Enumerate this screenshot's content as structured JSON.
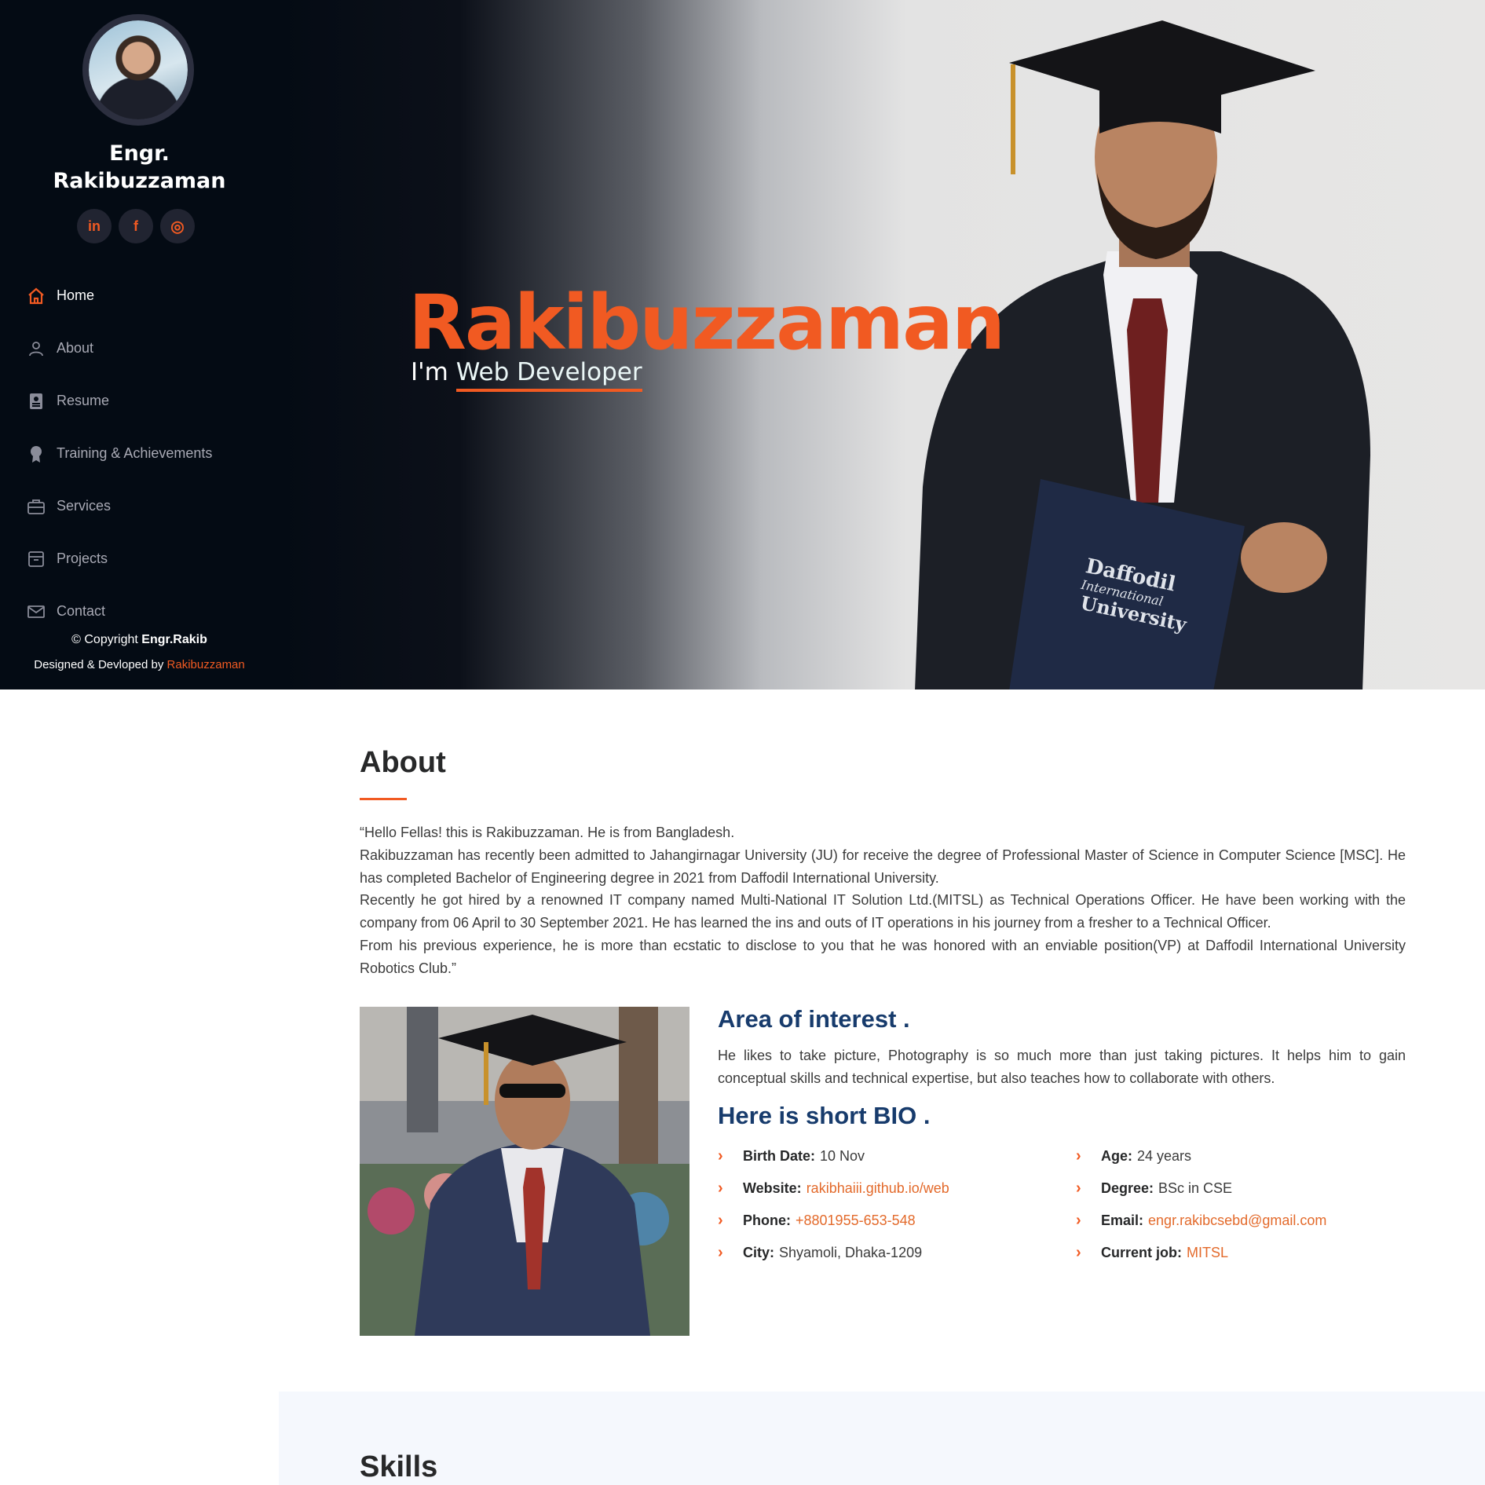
{
  "profile": {
    "name": "Engr. Rakibuzzaman"
  },
  "social": [
    {
      "icon": "linkedin-icon",
      "glyph": "in"
    },
    {
      "icon": "facebook-icon",
      "glyph": "f"
    },
    {
      "icon": "instagram-icon",
      "glyph": "◎"
    }
  ],
  "nav": [
    {
      "label": "Home",
      "icon": "home-icon",
      "active": true
    },
    {
      "label": "About",
      "icon": "person-icon"
    },
    {
      "label": "Resume",
      "icon": "resume-icon"
    },
    {
      "label": "Training & Achievements",
      "icon": "award-icon"
    },
    {
      "label": "Services",
      "icon": "briefcase-icon"
    },
    {
      "label": "Projects",
      "icon": "archive-icon"
    },
    {
      "label": "Contact",
      "icon": "envelope-icon"
    }
  ],
  "footer": {
    "copyright_prefix": "© Copyright ",
    "copyright_name": "Engr.Rakib",
    "designed_prefix": "Designed & Devloped by ",
    "designed_name": "Rakibuzzaman"
  },
  "hero": {
    "title": "Rakibuzzaman",
    "prefix": "I'm ",
    "typed": "Web Developer",
    "book_text_1": "Daffodil",
    "book_text_2": "International",
    "book_text_3": "University"
  },
  "about": {
    "title": "About",
    "paragraphs": [
      "“Hello Fellas! this is Rakibuzzaman. He is from Bangladesh.",
      "Rakibuzzaman has recently been admitted to Jahangirnagar University (JU) for receive the degree of Professional Master of Science in Computer Science [MSC]. He has completed Bachelor of Engineering degree in 2021 from Daffodil International University.",
      "Recently he got hired by a renowned IT company named Multi-National IT Solution Ltd.(MITSL) as Technical Operations Officer. He have been working with the company from 06 April to 30 September 2021. He has learned the ins and outs of IT operations in his journey from a fresher to a Technical Officer.",
      "From his previous experience, he is more than ecstatic to disclose to you that he was honored with an enviable position(VP) at Daffodil International University Robotics Club.”"
    ],
    "interest_title": "Area of interest .",
    "interest_text": "He likes to take picture, Photography is so much more than just taking pictures. It helps him to gain conceptual skills and technical expertise, but also teaches how to collaborate with others.",
    "bio_title": "Here is short BIO .",
    "bio_left": [
      {
        "label": "Birth Date:",
        "value": "10 Nov",
        "link": false
      },
      {
        "label": "Website:",
        "value": "rakibhaiii.github.io/web",
        "link": true
      },
      {
        "label": "Phone:",
        "value": "+8801955-653-548",
        "link": true
      },
      {
        "label": "City:",
        "value": "Shyamoli, Dhaka-1209",
        "link": false
      }
    ],
    "bio_right": [
      {
        "label": "Age:",
        "value": "24 years",
        "link": false
      },
      {
        "label": "Degree:",
        "value": "BSc in CSE",
        "link": false
      },
      {
        "label": "Email:",
        "value": "engr.rakibcsebd@gmail.com",
        "link": true
      },
      {
        "label": "Current job:",
        "value": "MITSL",
        "link": true
      }
    ]
  },
  "skills": {
    "title": "Skills"
  },
  "colors": {
    "accent": "#f15a22",
    "sidebar_bg": "#040b14",
    "heading_blue": "#173b6c"
  }
}
